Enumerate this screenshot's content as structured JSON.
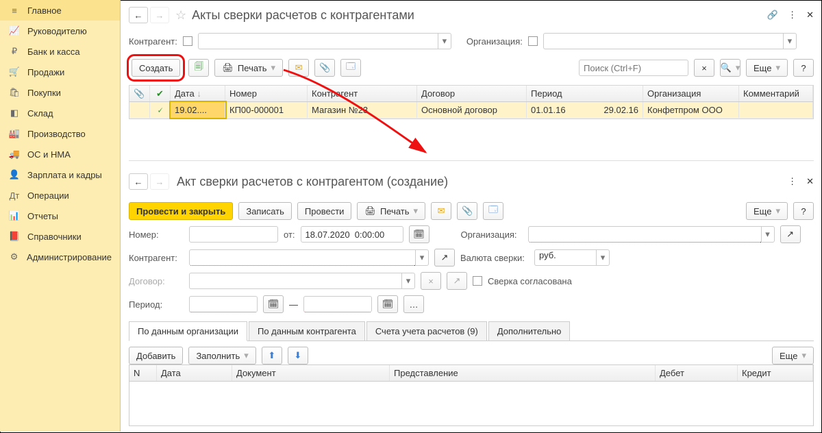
{
  "sidebar": {
    "items": [
      {
        "icon": "menu",
        "label": "Главное"
      },
      {
        "icon": "chart",
        "label": "Руководителю"
      },
      {
        "icon": "ruble",
        "label": "Банк и касса"
      },
      {
        "icon": "cart",
        "label": "Продажи"
      },
      {
        "icon": "basket",
        "label": "Покупки"
      },
      {
        "icon": "warehouse",
        "label": "Склад"
      },
      {
        "icon": "factory",
        "label": "Производство"
      },
      {
        "icon": "truck",
        "label": "ОС и НМА"
      },
      {
        "icon": "person",
        "label": "Зарплата и кадры"
      },
      {
        "icon": "ops",
        "label": "Операции"
      },
      {
        "icon": "bars",
        "label": "Отчеты"
      },
      {
        "icon": "book",
        "label": "Справочники"
      },
      {
        "icon": "gear",
        "label": "Администрирование"
      }
    ]
  },
  "top": {
    "title": "Акты сверки расчетов с контрагентами",
    "labels": {
      "counterparty": "Контрагент:",
      "org": "Организация:"
    },
    "toolbar": {
      "create": "Создать",
      "print": "Печать",
      "search_ph": "Поиск (Ctrl+F)",
      "more": "Еще"
    },
    "grid": {
      "cols": {
        "date": "Дата",
        "num": "Номер",
        "contr": "Контрагент",
        "dogo": "Договор",
        "per": "Период",
        "org": "Организация",
        "com": "Комментарий"
      },
      "row": {
        "date": "19.02....",
        "num": "КП00-000001",
        "contr": "Магазин №23",
        "dogo": "Основной договор",
        "per1": "01.01.16",
        "per2": "29.02.16",
        "org": "Конфетпром ООО"
      }
    }
  },
  "form": {
    "title": "Акт сверки расчетов с контрагентом (создание)",
    "btns": {
      "post_close": "Провести и закрыть",
      "save": "Записать",
      "post": "Провести",
      "print": "Печать",
      "more": "Еще"
    },
    "labels": {
      "num": "Номер:",
      "from": "от:",
      "org": "Организация:",
      "contr": "Контрагент:",
      "cur": "Валюта сверки:",
      "dogo": "Договор:",
      "agreed": "Сверка согласована",
      "period": "Период:"
    },
    "values": {
      "date": "18.07.2020  0:00:00",
      "cur": "руб."
    },
    "tabs": [
      "По данным организации",
      "По данным контрагента",
      "Счета учета расчетов (9)",
      "Дополнительно"
    ],
    "toolbar2": {
      "add": "Добавить",
      "fill": "Заполнить",
      "more": "Еще"
    },
    "grid2": {
      "n": "N",
      "date": "Дата",
      "doc": "Документ",
      "rep": "Представление",
      "deb": "Дебет",
      "kre": "Кредит"
    }
  }
}
